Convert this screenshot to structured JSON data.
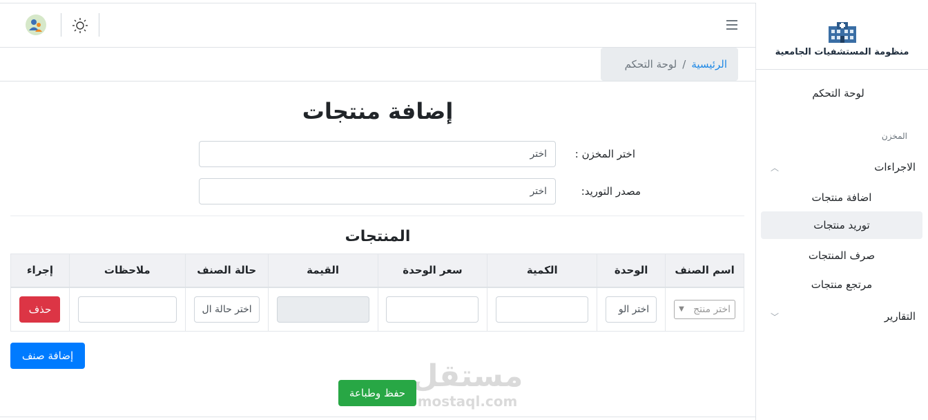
{
  "sidebar": {
    "brand_title": "منظومة المستشفيات الجامعية",
    "dashboard": "لوحة التحكم",
    "section_label": "المخزن",
    "procedures_label": "الاجراءات",
    "procedures_items": [
      "اضافة منتجات",
      "توريد منتجات",
      "صرف المنتجات",
      "مرتجع منتجات"
    ],
    "active_item": "توريد منتجات",
    "reports_label": "التقارير"
  },
  "header": {
    "icons": [
      "avatar-icon",
      "sun-icon",
      "menu-icon"
    ]
  },
  "breadcrumb": {
    "home": "الرئيسية",
    "separator": "/",
    "current": "لوحة التحكم"
  },
  "page": {
    "title": "إضافة منتجات",
    "warehouse_label": "اختر المخزن :",
    "warehouse_value": "اختر",
    "supply_label": "مصدر التوريد:",
    "supply_value": "اختر",
    "products_title": "المنتجات"
  },
  "table": {
    "headers": [
      "اسم الصنف",
      "الوحدة",
      "الكمية",
      "سعر الوحدة",
      "القيمة",
      "حالة الصنف",
      "ملاحظات",
      "إجراء"
    ],
    "row": {
      "product_placeholder": "اختر منتج",
      "unit_placeholder": "اختر الو",
      "quantity": "",
      "unit_price": "",
      "value": "",
      "status_placeholder": "اختر حالة ال",
      "notes": "",
      "delete_label": "حذف"
    }
  },
  "buttons": {
    "add_item": "إضافة صنف",
    "save_print": "حفظ وطباعة"
  },
  "watermark": {
    "arabic": "مستقل",
    "latin": "mostaql.com"
  },
  "colors": {
    "primary": "#007bff",
    "danger": "#dc3545",
    "success": "#28a745",
    "link": "#1e88e5"
  }
}
